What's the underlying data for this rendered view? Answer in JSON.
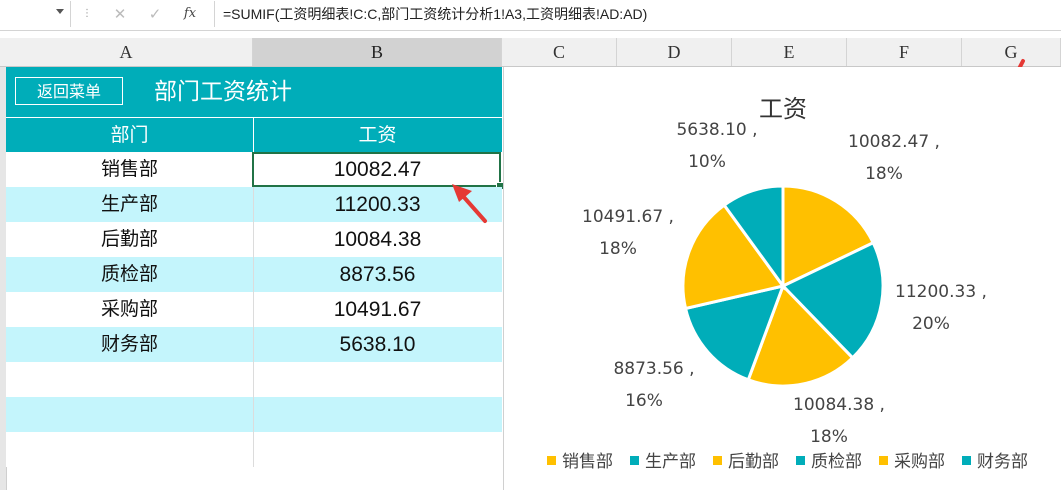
{
  "formula_bar": {
    "formula": "=SUMIF(工资明细表!C:C,部门工资统计分析1!A3,工资明细表!AD:AD)",
    "fx_label": "fx",
    "cancel_glyph": "✕",
    "enter_glyph": "✓"
  },
  "columns": [
    "A",
    "B",
    "C",
    "D",
    "E",
    "F",
    "G"
  ],
  "sheet": {
    "back_button": "返回菜单",
    "title": "部门工资统计",
    "headers": {
      "dept": "部门",
      "salary": "工资"
    },
    "rows": [
      {
        "dept": "销售部",
        "salary": "10082.47"
      },
      {
        "dept": "生产部",
        "salary": "11200.33"
      },
      {
        "dept": "后勤部",
        "salary": "10084.38"
      },
      {
        "dept": "质检部",
        "salary": "8873.56"
      },
      {
        "dept": "采购部",
        "salary": "10491.67"
      },
      {
        "dept": "财务部",
        "salary": "5638.10"
      }
    ],
    "selected_cell": "B3"
  },
  "colors": {
    "teal": "#00adb9",
    "gold": "#ffc000",
    "band": "#c4f5fc",
    "arrow": "#e53935"
  },
  "chart_data": {
    "type": "pie",
    "title": "工资",
    "categories": [
      "销售部",
      "生产部",
      "后勤部",
      "质检部",
      "采购部",
      "财务部"
    ],
    "values": [
      10082.47,
      11200.33,
      10084.38,
      8873.56,
      10491.67,
      5638.1
    ],
    "data_labels": [
      "10082.47 ,",
      "11200.33 ,",
      "10084.38 ,",
      "8873.56 ,",
      "10491.67 ,",
      "5638.10 ,"
    ],
    "percent_labels": [
      "18%",
      "20%",
      "18%",
      "16%",
      "18%",
      "10%"
    ],
    "colors": [
      "#ffc000",
      "#00adb9",
      "#ffc000",
      "#00adb9",
      "#ffc000",
      "#00adb9"
    ],
    "legend_position": "bottom"
  }
}
